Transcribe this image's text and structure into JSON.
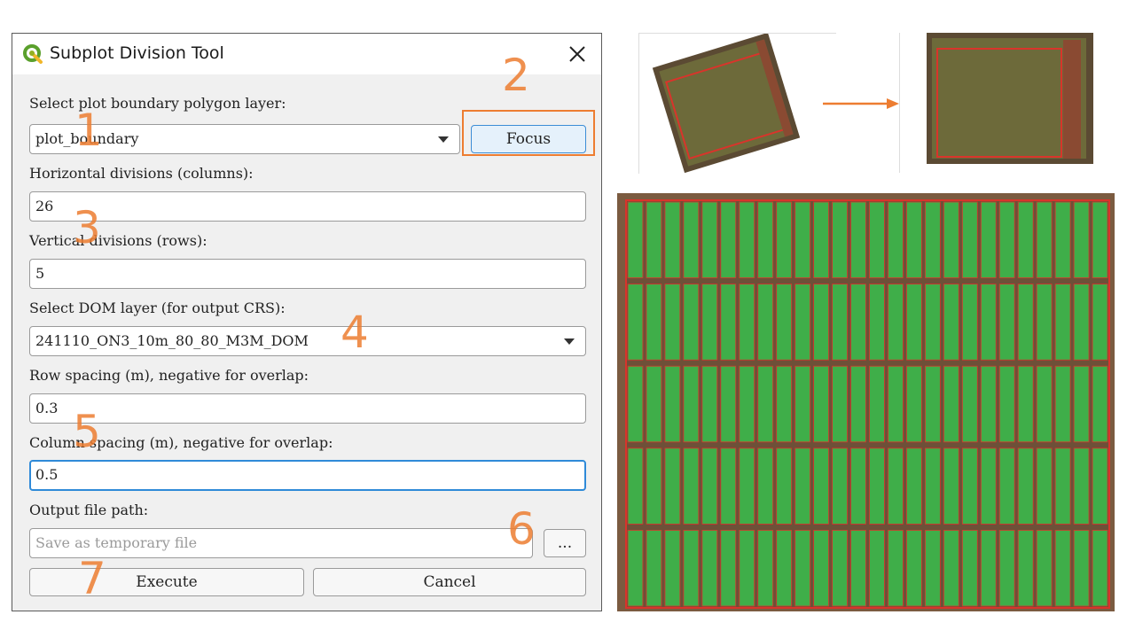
{
  "dialog": {
    "title": "Subplot Division Tool",
    "fields": {
      "boundary_label": "Select plot boundary polygon layer:",
      "boundary_value": "plot_boundary",
      "focus_label": "Focus",
      "columns_label": "Horizontal divisions (columns):",
      "columns_value": "26",
      "rows_label": "Vertical divisions (rows):",
      "rows_value": "5",
      "dom_label": "Select DOM layer (for output CRS):",
      "dom_value": "241110_ON3_10m_80_80_M3M_DOM",
      "row_spacing_label": "Row spacing (m), negative for overlap:",
      "row_spacing_value": "0.3",
      "col_spacing_label": "Column spacing (m), negative for overlap:",
      "col_spacing_value": "0.5",
      "output_label": "Output file path:",
      "output_placeholder": "Save as temporary file",
      "browse_label": "...",
      "execute_label": "Execute",
      "cancel_label": "Cancel"
    }
  },
  "callouts": [
    "1",
    "2",
    "3",
    "4",
    "5",
    "6",
    "7"
  ],
  "grid": {
    "columns": 26,
    "rows": 5
  },
  "colors": {
    "callout": "#ed7d31",
    "plot_fill": "#3fae49",
    "boundary": "#d9342b",
    "focus_border": "#2f8ad8"
  }
}
